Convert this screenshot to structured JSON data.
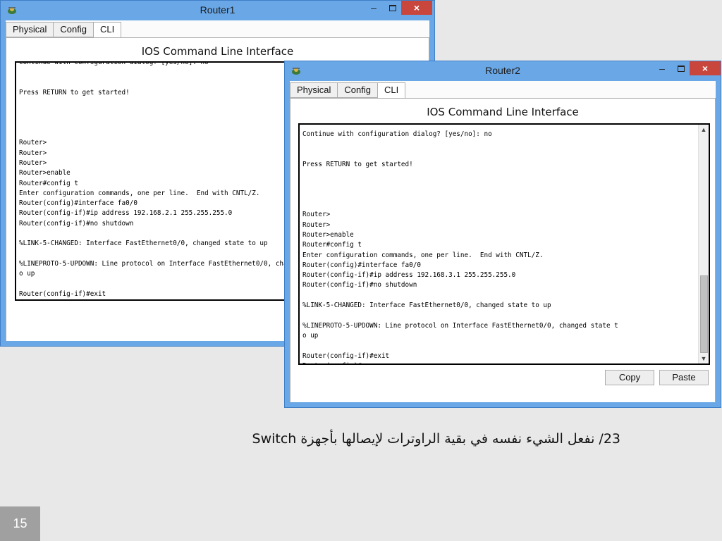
{
  "router1": {
    "title": "Router1",
    "tabs": [
      "Physical",
      "Config",
      "CLI"
    ],
    "header": "IOS Command Line Interface",
    "console_text": "Continue with configuration dialog? [yes/no]: no\n\n\nPress RETURN to get started!\n\n\n\n\nRouter>\nRouter>\nRouter>\nRouter>enable\nRouter#config t\nEnter configuration commands, one per line.  End with CNTL/Z.\nRouter(config)#interface fa0/0\nRouter(config-if)#ip address 192.168.2.1 255.255.255.0\nRouter(config-if)#no shutdown\n\n%LINK-5-CHANGED: Interface FastEthernet0/0, changed state to up\n\n%LINEPROTO-5-UPDOWN: Line protocol on Interface FastEthernet0/0, changed state t\no up\n\nRouter(config-if)#exit\nRouter(config)#"
  },
  "router2": {
    "title": "Router2",
    "tabs": [
      "Physical",
      "Config",
      "CLI"
    ],
    "header": "IOS Command Line Interface",
    "console_text": "Continue with configuration dialog? [yes/no]: no\n\n\nPress RETURN to get started!\n\n\n\n\nRouter>\nRouter>\nRouter>enable\nRouter#config t\nEnter configuration commands, one per line.  End with CNTL/Z.\nRouter(config)#interface fa0/0\nRouter(config-if)#ip address 192.168.3.1 255.255.255.0\nRouter(config-if)#no shutdown\n\n%LINK-5-CHANGED: Interface FastEthernet0/0, changed state to up\n\n%LINEPROTO-5-UPDOWN: Line protocol on Interface FastEthernet0/0, changed state t\no up\n\nRouter(config-if)#exit\nRouter(config)#",
    "copy_label": "Copy",
    "paste_label": "Paste"
  },
  "window_controls": {
    "minimize": "–",
    "close": "×"
  },
  "caption": "23/ نفعل الشيء نفسه في بقية الراوترات لإيصالها بأجهزة Switch",
  "slide_number": "15",
  "colors": {
    "titlebar": "#6aa7e6",
    "close": "#c9463d"
  },
  "icons": {
    "app": "packet-tracer-router-icon"
  }
}
